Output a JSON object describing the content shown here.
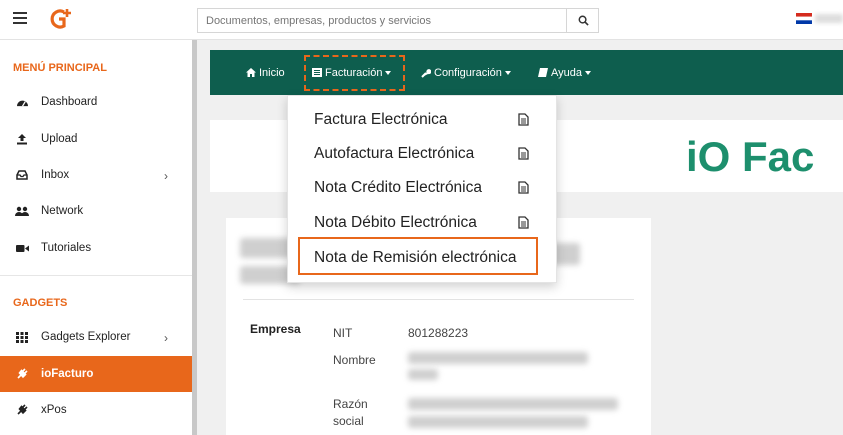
{
  "header": {
    "search_placeholder": "Documentos, empresas, productos y servicios",
    "search_icon": "search-icon",
    "menu_icon": "hamburger-icon",
    "logo_icon": "g-plus-logo",
    "flag_icon": "paraguay-flag-icon"
  },
  "sidebar": {
    "main_title": "MENÚ PRINCIPAL",
    "main_items": [
      {
        "label": "Dashboard",
        "icon": "dashboard-icon"
      },
      {
        "label": "Upload",
        "icon": "upload-icon"
      },
      {
        "label": "Inbox",
        "icon": "inbox-icon"
      },
      {
        "label": "Network",
        "icon": "network-icon"
      },
      {
        "label": "Tutoriales",
        "icon": "video-icon"
      }
    ],
    "gadgets_title": "GADGETS",
    "gadget_items": [
      {
        "label": "Gadgets Explorer",
        "icon": "grid-icon"
      },
      {
        "label": "ioFacturo",
        "icon": "plug-icon",
        "active": true
      },
      {
        "label": "xPos",
        "icon": "plug-icon"
      }
    ]
  },
  "navbar": {
    "items": [
      {
        "label": "Inicio",
        "icon": "home-icon"
      },
      {
        "label": "Facturación",
        "icon": "list-icon"
      },
      {
        "label": "Configuración",
        "icon": "wrench-icon"
      },
      {
        "label": "Ayuda",
        "icon": "book-icon"
      }
    ]
  },
  "dropdown": {
    "items": [
      {
        "label": "Factura Electrónica",
        "icon": "document-icon"
      },
      {
        "label": "Autofactura Electrónica",
        "icon": "document-icon"
      },
      {
        "label": "Nota Crédito Electrónica",
        "icon": "document-icon"
      },
      {
        "label": "Nota Débito Electrónica",
        "icon": "document-icon"
      },
      {
        "label": "Nota de Remisión electrónica",
        "highlighted": true
      }
    ]
  },
  "brand": {
    "text": "iO Fac"
  },
  "company": {
    "section_label": "Empresa",
    "nit_label": "NIT",
    "nit_value": "801288223",
    "nombre_label": "Nombre",
    "razon_label_line1": "Razón",
    "razon_label_line2": "social"
  },
  "colors": {
    "accent": "#e8671b",
    "navbar": "#0e5e4e",
    "brand": "#1d8f6d"
  }
}
